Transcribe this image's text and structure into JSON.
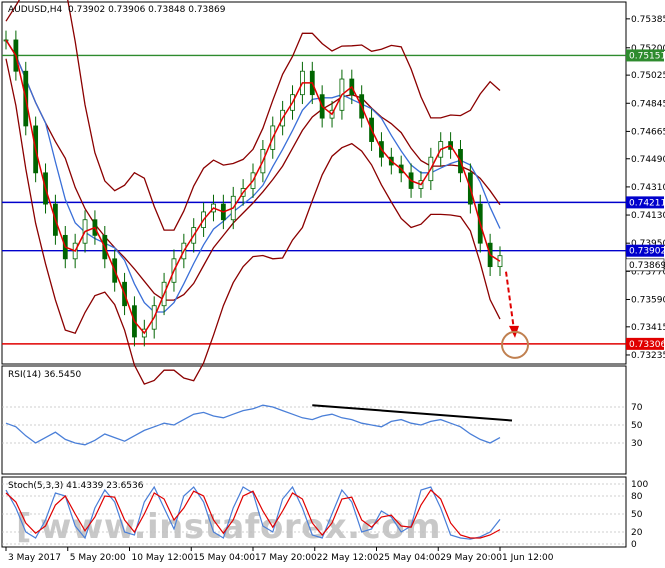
{
  "header": {
    "symbol_label": "AUDUSD,H4",
    "ohlc": "0.73902 0.73906 0.73848 0.73869"
  },
  "watermark": {
    "text": "www.instaforex.com",
    "bracket": "["
  },
  "chart_data": [
    {
      "type": "candlestick",
      "title": "",
      "price_ticks": [
        "0.75385",
        "0.75200",
        "0.75025",
        "0.74845",
        "0.74665",
        "0.74490",
        "0.74310",
        "0.74130",
        "0.73950",
        "0.73770",
        "0.73590",
        "0.73415",
        "0.73235"
      ],
      "ylim": [
        0.7319,
        0.7548
      ],
      "x_labels": [
        "3 May 2017",
        "5 May 20:00",
        "10 May 12:00",
        "15 May 04:00",
        "17 May 20:00",
        "22 May 12:00",
        "25 May 04:00",
        "29 May 20:00",
        "1 Jun 12:00"
      ],
      "horizontal_lines": [
        {
          "value": 0.75151,
          "label": "0.75151",
          "color": "#2e8b2e"
        },
        {
          "value": 0.74211,
          "label": "0.74211",
          "color": "#0000cc"
        },
        {
          "value": 0.73902,
          "label": "0.73902",
          "color": "#0000cc"
        },
        {
          "value": 0.73306,
          "label": "0.73306",
          "color": "#e00000"
        }
      ],
      "current_price": {
        "value": 0.73869,
        "label": "0.73869"
      },
      "close_series": [
        0.7525,
        0.7505,
        0.747,
        0.744,
        0.742,
        0.74,
        0.7385,
        0.7395,
        0.741,
        0.74,
        0.7385,
        0.737,
        0.7355,
        0.7335,
        0.734,
        0.7355,
        0.737,
        0.7385,
        0.7395,
        0.7405,
        0.7415,
        0.742,
        0.741,
        0.7425,
        0.743,
        0.744,
        0.7455,
        0.747,
        0.748,
        0.749,
        0.7505,
        0.749,
        0.7475,
        0.748,
        0.75,
        0.749,
        0.7475,
        0.746,
        0.745,
        0.7445,
        0.744,
        0.743,
        0.7435,
        0.745,
        0.746,
        0.7455,
        0.744,
        0.742,
        0.7395,
        0.738,
        0.7387
      ],
      "forecast_arrow_target": 0.73306,
      "colors": {
        "candle": "#006400",
        "ma_fast": "#e00000",
        "ma_mid": "#8b0000",
        "ma_slow": "#3a6fd8",
        "bands": "#8b0000"
      }
    },
    {
      "type": "line",
      "title": "RSI(14) 36.5450",
      "ylim": [
        0,
        100
      ],
      "levels": [
        "70",
        "50",
        "30"
      ],
      "values": [
        52,
        48,
        38,
        30,
        36,
        42,
        34,
        30,
        28,
        33,
        40,
        36,
        32,
        38,
        44,
        48,
        52,
        50,
        56,
        62,
        64,
        60,
        58,
        62,
        66,
        68,
        72,
        70,
        66,
        62,
        58,
        56,
        60,
        62,
        58,
        56,
        52,
        50,
        48,
        54,
        56,
        52,
        50,
        54,
        56,
        52,
        48,
        40,
        34,
        30,
        36
      ],
      "trendline": {
        "from": 72,
        "to": 55
      },
      "colors": {
        "line": "#4a7fd8",
        "trend": "#000000"
      }
    },
    {
      "type": "line",
      "title": "Stoch(5,3,3) 41.4339 23.6536",
      "ylim": [
        0,
        100
      ],
      "levels": [
        "100",
        "80",
        "50",
        "20",
        "0"
      ],
      "main": [
        90,
        60,
        20,
        10,
        40,
        85,
        80,
        30,
        10,
        60,
        90,
        70,
        20,
        15,
        70,
        95,
        60,
        25,
        80,
        95,
        70,
        20,
        10,
        60,
        95,
        85,
        30,
        20,
        75,
        95,
        60,
        15,
        10,
        50,
        90,
        70,
        20,
        25,
        55,
        45,
        20,
        30,
        90,
        95,
        60,
        15,
        10,
        8,
        12,
        20,
        41
      ],
      "signal": [
        85,
        70,
        35,
        18,
        30,
        65,
        80,
        50,
        22,
        45,
        80,
        78,
        40,
        20,
        50,
        85,
        75,
        40,
        60,
        88,
        80,
        40,
        18,
        40,
        80,
        88,
        55,
        28,
        55,
        85,
        75,
        35,
        15,
        35,
        75,
        78,
        40,
        28,
        45,
        48,
        30,
        28,
        65,
        90,
        75,
        35,
        15,
        10,
        10,
        15,
        24
      ],
      "colors": {
        "main": "#4a7fd8",
        "signal": "#e00000"
      }
    }
  ]
}
